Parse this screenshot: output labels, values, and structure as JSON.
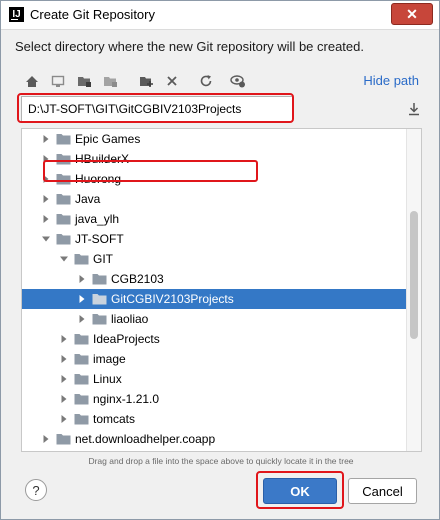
{
  "window": {
    "title": "Create Git Repository",
    "app_icon_text": "IJ"
  },
  "description": "Select directory where the new Git repository will be created.",
  "toolbar": {
    "icons": [
      "home-icon",
      "desktop-icon",
      "project-folder-icon",
      "module-folder-icon",
      "new-folder-icon",
      "delete-icon",
      "refresh-icon",
      "show-hidden-icon"
    ],
    "hide_path_label": "Hide path"
  },
  "path": {
    "value": "D:\\JT-SOFT\\GIT\\GitCGBIV2103Projects"
  },
  "tree": {
    "items": [
      {
        "label": "Epic Games",
        "expanded": false,
        "selected": false
      },
      {
        "label": "HBuilderX",
        "expanded": false,
        "selected": false
      },
      {
        "label": "Huorong",
        "expanded": false,
        "selected": false
      },
      {
        "label": "Java",
        "expanded": false,
        "selected": false
      },
      {
        "label": "java_ylh",
        "expanded": false,
        "selected": false
      },
      {
        "label": "JT-SOFT",
        "expanded": true,
        "selected": false
      },
      {
        "label": "GIT",
        "expanded": true,
        "selected": false
      },
      {
        "label": "CGB2103",
        "expanded": false,
        "selected": false
      },
      {
        "label": "GitCGBIV2103Projects",
        "expanded": false,
        "selected": true
      },
      {
        "label": "liaoliao",
        "expanded": false,
        "selected": false
      },
      {
        "label": "IdeaProjects",
        "expanded": false,
        "selected": false
      },
      {
        "label": "image",
        "expanded": false,
        "selected": false
      },
      {
        "label": "Linux",
        "expanded": false,
        "selected": false
      },
      {
        "label": "nginx-1.21.0",
        "expanded": false,
        "selected": false
      },
      {
        "label": "tomcats",
        "expanded": false,
        "selected": false
      },
      {
        "label": "net.downloadhelper.coapp",
        "expanded": false,
        "selected": false
      }
    ]
  },
  "hint": "Drag and drop a file into the space above to quickly locate it in the tree",
  "buttons": {
    "help": "?",
    "ok": "OK",
    "cancel": "Cancel"
  },
  "colors": {
    "selection": "#3478c6",
    "highlight_box": "#e0161b",
    "link": "#2a6bc8",
    "folder": "#8f9aa6"
  }
}
